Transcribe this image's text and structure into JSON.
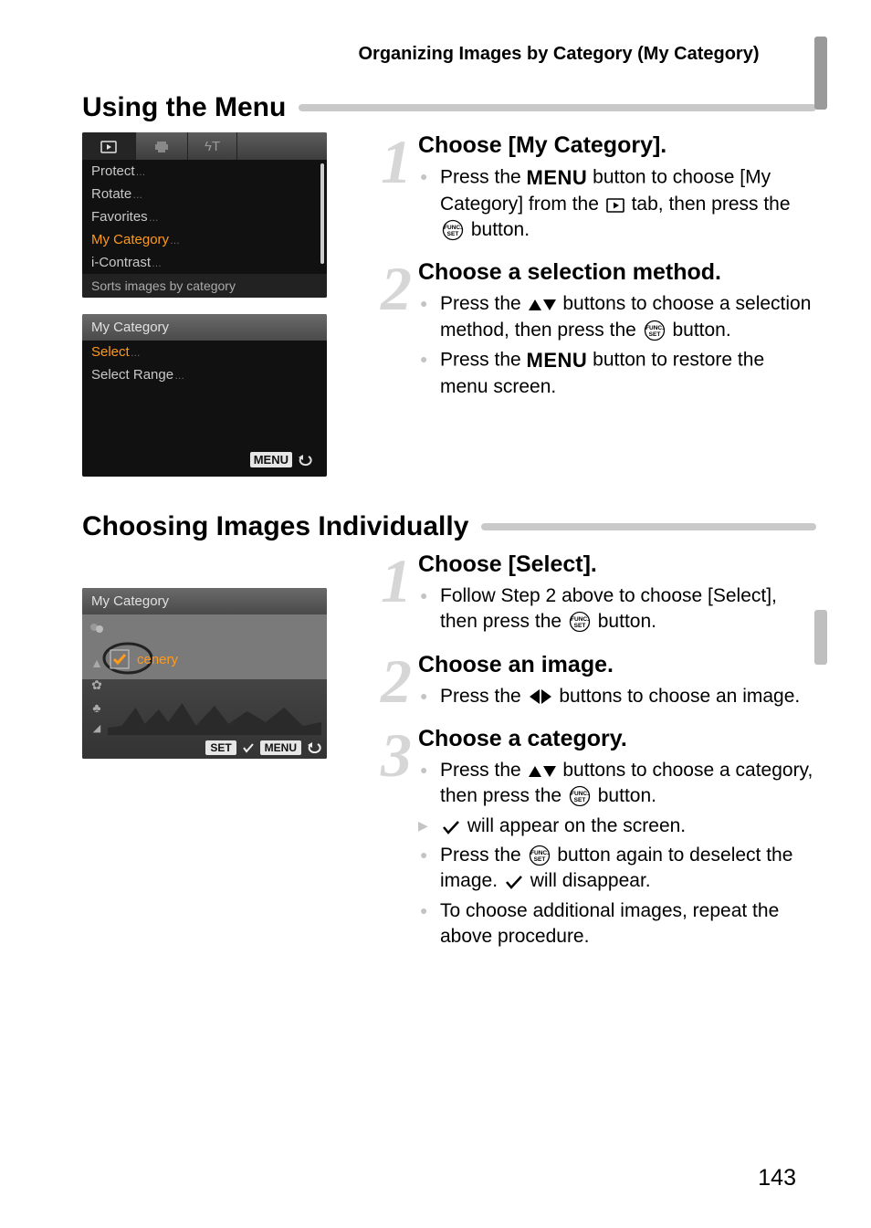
{
  "header": "Organizing Images by Category (My Category)",
  "sec1": "Using the Menu",
  "sec2": "Choosing Images Individually",
  "cam_menu": {
    "items": [
      "Protect",
      "Rotate",
      "Favorites",
      "My Category",
      "i-Contrast"
    ],
    "highlight_index": 3,
    "footer": "Sorts images by category"
  },
  "cam_select": {
    "title": "My Category",
    "items": [
      "Select",
      "Select Range"
    ],
    "highlight_index": 0,
    "menu_label": "MENU"
  },
  "cam_image": {
    "title": "My Category",
    "caption": "cenery",
    "set_label": "SET",
    "menu_label": "MENU"
  },
  "steps_a": [
    {
      "num": "1",
      "title": "Choose [My Category].",
      "bullets": [
        {
          "type": "dot",
          "segments": [
            {
              "t": "Press the "
            },
            {
              "glyph": "menu"
            },
            {
              "t": " button to choose [My Category] from the "
            },
            {
              "glyph": "play"
            },
            {
              "t": " tab, then press the "
            },
            {
              "glyph": "func"
            },
            {
              "t": " button."
            }
          ]
        }
      ]
    },
    {
      "num": "2",
      "title": "Choose a selection method.",
      "bullets": [
        {
          "type": "dot",
          "segments": [
            {
              "t": "Press the "
            },
            {
              "glyph": "updown"
            },
            {
              "t": " buttons to choose a selection method, then press the "
            },
            {
              "glyph": "func"
            },
            {
              "t": " button."
            }
          ]
        },
        {
          "type": "dot",
          "segments": [
            {
              "t": "Press the "
            },
            {
              "glyph": "menu"
            },
            {
              "t": " button to restore the menu screen."
            }
          ]
        }
      ]
    }
  ],
  "steps_b": [
    {
      "num": "1",
      "title": "Choose [Select].",
      "bullets": [
        {
          "type": "dot",
          "segments": [
            {
              "t": "Follow Step 2 above to choose [Select], then press the "
            },
            {
              "glyph": "func"
            },
            {
              "t": " button."
            }
          ]
        }
      ]
    },
    {
      "num": "2",
      "title": "Choose an image.",
      "bullets": [
        {
          "type": "dot",
          "segments": [
            {
              "t": "Press the "
            },
            {
              "glyph": "leftright"
            },
            {
              "t": " buttons to choose an image."
            }
          ]
        }
      ]
    },
    {
      "num": "3",
      "title": "Choose a category.",
      "bullets": [
        {
          "type": "dot",
          "segments": [
            {
              "t": "Press the "
            },
            {
              "glyph": "updown"
            },
            {
              "t": " buttons to choose a category, then press the "
            },
            {
              "glyph": "func"
            },
            {
              "t": " button."
            }
          ]
        },
        {
          "type": "tri",
          "segments": [
            {
              "glyph": "check"
            },
            {
              "t": " will appear on the screen."
            }
          ]
        },
        {
          "type": "dot",
          "segments": [
            {
              "t": "Press the "
            },
            {
              "glyph": "func"
            },
            {
              "t": " button again to deselect the image. "
            },
            {
              "glyph": "check"
            },
            {
              "t": " will disappear."
            }
          ]
        },
        {
          "type": "dot",
          "segments": [
            {
              "t": "To choose additional images, repeat the above procedure."
            }
          ]
        }
      ]
    }
  ],
  "page_number": "143"
}
